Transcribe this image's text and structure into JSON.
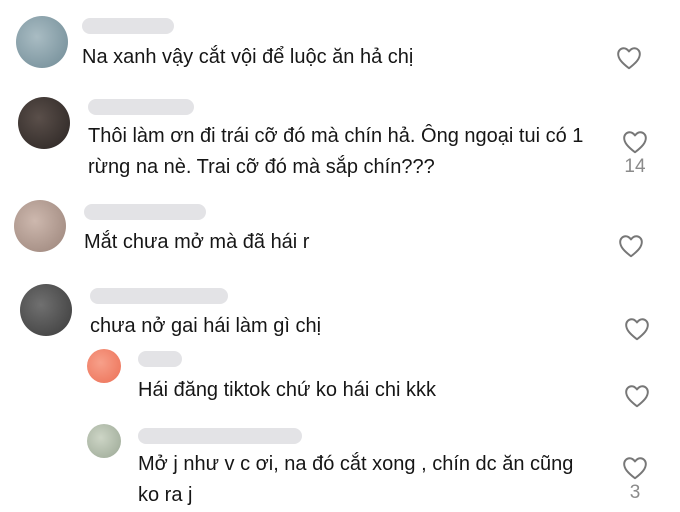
{
  "comments": [
    {
      "text": "Na xanh vậy cắt vội để luộc ăn hả chị",
      "avatar_color": "#7e98a4",
      "likes": ""
    },
    {
      "text": "Thôi làm ơn đi trái cỡ đó mà chín hả. Ông ngoại tui có 1 rừng na nè. Trai cỡ đó mà sắp chín???",
      "avatar_color": "#3a3230",
      "likes": "14"
    },
    {
      "text": "Mắt chưa mở mà đã hái r",
      "avatar_color": "#b59f96",
      "likes": ""
    },
    {
      "text": "chưa nở gai hái làm gì chị",
      "avatar_color": "#4b4b4b",
      "likes": ""
    }
  ],
  "replies": [
    {
      "text": "Hái đăng tiktok chứ ko hái chi kkk",
      "avatar_color": "#f0846a",
      "likes": ""
    },
    {
      "text": "Mở j như v c ơi, na đó cắt xong , chín dc ăn cũng ko ra j",
      "avatar_color": "#b8c2b2",
      "likes": "3"
    }
  ],
  "icons": {
    "like": "heart-outline-icon"
  }
}
